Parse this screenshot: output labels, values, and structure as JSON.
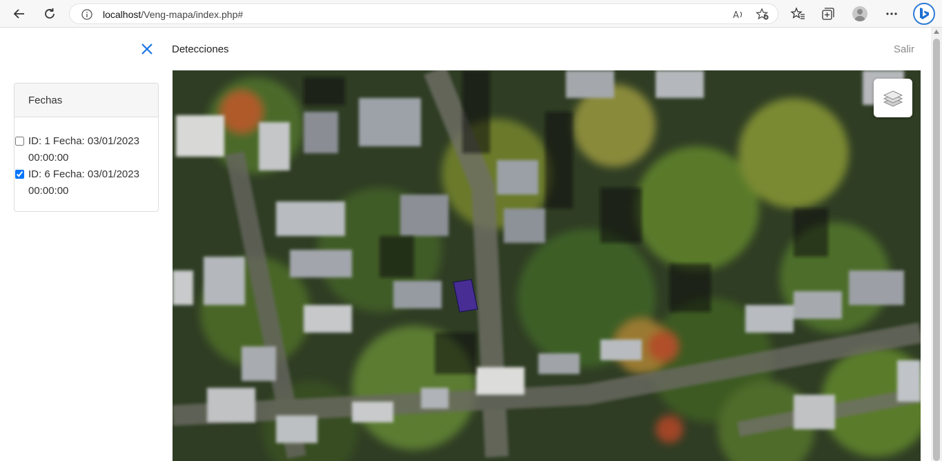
{
  "browser": {
    "url_host": "localhost",
    "url_path": "/Veng-mapa/index.php#"
  },
  "header": {
    "title": "Detecciones",
    "logout_label": "Salir"
  },
  "sidebar": {
    "panel_title": "Fechas",
    "items": [
      {
        "label": "ID: 1 Fecha: 03/01/2023 00:00:00",
        "checked": false
      },
      {
        "label": "ID: 6 Fecha: 03/01/2023 00:00:00",
        "checked": true
      }
    ]
  },
  "map": {
    "detection_color": "#4b2aa8",
    "layers_icon": "layers-icon"
  },
  "colors": {
    "accent": "#1a73e8",
    "muted": "#8a8a8a"
  }
}
